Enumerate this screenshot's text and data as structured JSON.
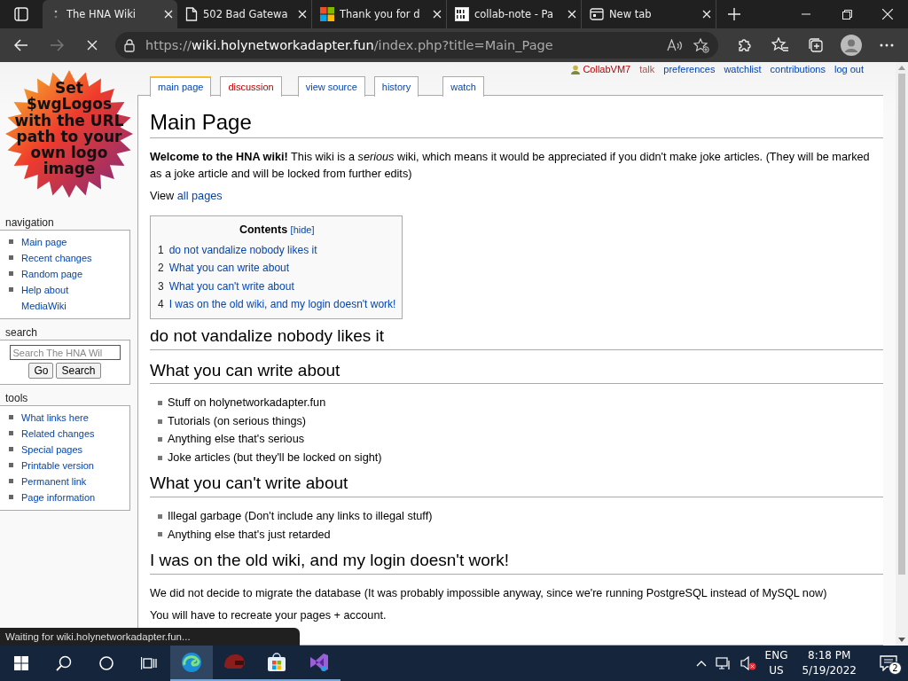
{
  "browser": {
    "tabs": [
      {
        "title": "The HNA Wiki",
        "selected": true
      },
      {
        "title": "502 Bad Gatewa",
        "selected": false
      },
      {
        "title": "Thank you for d",
        "selected": false
      },
      {
        "title": "collab-note - Pa",
        "selected": false
      },
      {
        "title": "New tab",
        "selected": false
      }
    ],
    "address": {
      "scheme": "https://",
      "host": "wiki.holynetworkadapter.fun",
      "path": "/index.php?title=Main_Page"
    }
  },
  "wiki": {
    "user_links": [
      {
        "label": "CollabVM7",
        "kind": "user"
      },
      {
        "label": "talk",
        "kind": "new"
      },
      {
        "label": "preferences",
        "kind": "link"
      },
      {
        "label": "watchlist",
        "kind": "link"
      },
      {
        "label": "contributions",
        "kind": "link"
      },
      {
        "label": "log out",
        "kind": "link"
      }
    ],
    "page_tabs": [
      {
        "label": "main page",
        "selected": true,
        "exists": true
      },
      {
        "label": "discussion",
        "selected": false,
        "exists": false
      },
      {
        "label": "view source",
        "selected": false,
        "exists": true
      },
      {
        "label": "history",
        "selected": false,
        "exists": true
      },
      {
        "label": "watch",
        "selected": false,
        "exists": true
      }
    ],
    "logo_text": "Set $wgLogos with the URL path to your own logo image",
    "navigation": {
      "heading": "navigation",
      "items": [
        "Main page",
        "Recent changes",
        "Random page",
        "Help about MediaWiki"
      ]
    },
    "search": {
      "heading": "search",
      "placeholder": "Search The HNA Wil",
      "buttons": [
        "Go",
        "Search"
      ]
    },
    "tools": {
      "heading": "tools",
      "items": [
        "What links here",
        "Related changes",
        "Special pages",
        "Printable version",
        "Permanent link",
        "Page information"
      ]
    },
    "title": "Main Page",
    "intro": "**Welcome to the HNA wiki!** This wiki is a *serious* wiki, which means it would be appreciated if you didn't make joke articles. (They will be marked as a joke article and will be locked from further edits)",
    "view_line": {
      "text": "View",
      "link": "all pages"
    },
    "toc": {
      "title": "Contents",
      "toggle": "[hide]",
      "items": [
        {
          "number": "1",
          "label": "do not vandalize nobody likes it"
        },
        {
          "number": "2",
          "label": "What you can write about"
        },
        {
          "number": "3",
          "label": "What you can't write about"
        },
        {
          "number": "4",
          "label": "I was on the old wiki, and my login doesn't work!"
        }
      ]
    },
    "sections": [
      {
        "heading": "do not vandalize nobody likes it"
      },
      {
        "heading": "What you can write about",
        "items": [
          "Stuff on holynetworkadapter.fun",
          "Tutorials (on serious things)",
          "Anything else that's serious",
          "Joke articles (but they'll be locked on sight)"
        ]
      },
      {
        "heading": "What you can't write about",
        "items": [
          "Illegal garbage (Don't include any links to illegal stuff)",
          "Anything else that's just retarded"
        ]
      },
      {
        "heading": "I was on the old wiki, and my login doesn't work!",
        "paragraphs": [
          "We did not decide to migrate the database (It was probably impossible anyway, since we're running PostgreSQL instead of MySQL now)",
          "You will have to recreate your pages + account."
        ]
      }
    ]
  },
  "status": "Waiting for wiki.holynetworkadapter.fun...",
  "taskbar": {
    "apps": [
      {
        "selected": true
      },
      {
        "selected": false
      },
      {
        "selected": false
      },
      {
        "selected": false
      }
    ],
    "language": "ENG",
    "layout": "US",
    "time": "8:18 PM",
    "date": "5/19/2022",
    "notifications": "2"
  }
}
